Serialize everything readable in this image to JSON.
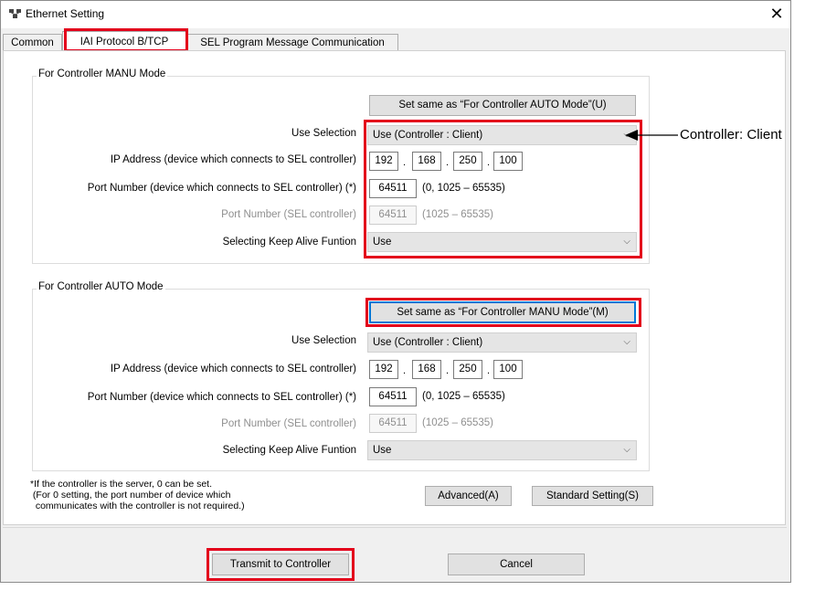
{
  "window": {
    "title": "Ethernet Setting",
    "close_glyph": "✕"
  },
  "tabs": [
    {
      "label": "Common"
    },
    {
      "label": "IAI Protocol B/TCP"
    },
    {
      "label": "SEL Program Message Communication"
    }
  ],
  "manu": {
    "group_label": "For Controller MANU Mode",
    "same_button": "Set same as “For Controller AUTO Mode”(U)",
    "use_selection_label": "Use Selection",
    "use_selection_value": "Use (Controller : Client)",
    "ip_label": "IP Address (device which connects to SEL controller)",
    "ip": [
      "192",
      "168",
      "250",
      "100"
    ],
    "port_label": "Port Number (device which connects to SEL controller) (*)",
    "port_value": "64511",
    "port_hint": "(0, 1025 – 65535)",
    "sel_port_label": "Port Number (SEL controller)",
    "sel_port_value": "64511",
    "sel_port_hint": "(1025 – 65535)",
    "keepalive_label": "Selecting Keep Alive Funtion",
    "keepalive_value": "Use"
  },
  "auto": {
    "group_label": "For Controller AUTO Mode",
    "same_button": "Set same as “For Controller MANU Mode”(M)",
    "use_selection_label": "Use Selection",
    "use_selection_value": "Use (Controller : Client)",
    "ip_label": "IP Address (device which connects to SEL controller)",
    "ip": [
      "192",
      "168",
      "250",
      "100"
    ],
    "port_label": "Port Number (device which connects to SEL controller) (*)",
    "port_value": "64511",
    "port_hint": "(0, 1025 – 65535)",
    "sel_port_label": "Port Number (SEL controller)",
    "sel_port_value": "64511",
    "sel_port_hint": "(1025 – 65535)",
    "keepalive_label": "Selecting Keep Alive Funtion",
    "keepalive_value": "Use"
  },
  "footnote": "*If the controller is the server, 0 can be set.\n (For 0 setting, the port number of device which\n  communicates with the controller is not required.)",
  "buttons": {
    "advanced": "Advanced(A)",
    "standard": "Standard Setting(S)",
    "transmit": "Transmit to Controller",
    "cancel": "Cancel"
  },
  "annotation": {
    "callout": "Controller: Client"
  },
  "colors": {
    "highlight": "#e3001b",
    "focus": "#0078d7"
  },
  "icons": {
    "app": "ethernet-app-icon",
    "close": "close-icon",
    "dropdown": "chevron-down-icon",
    "arrow": "left-arrow-icon"
  }
}
